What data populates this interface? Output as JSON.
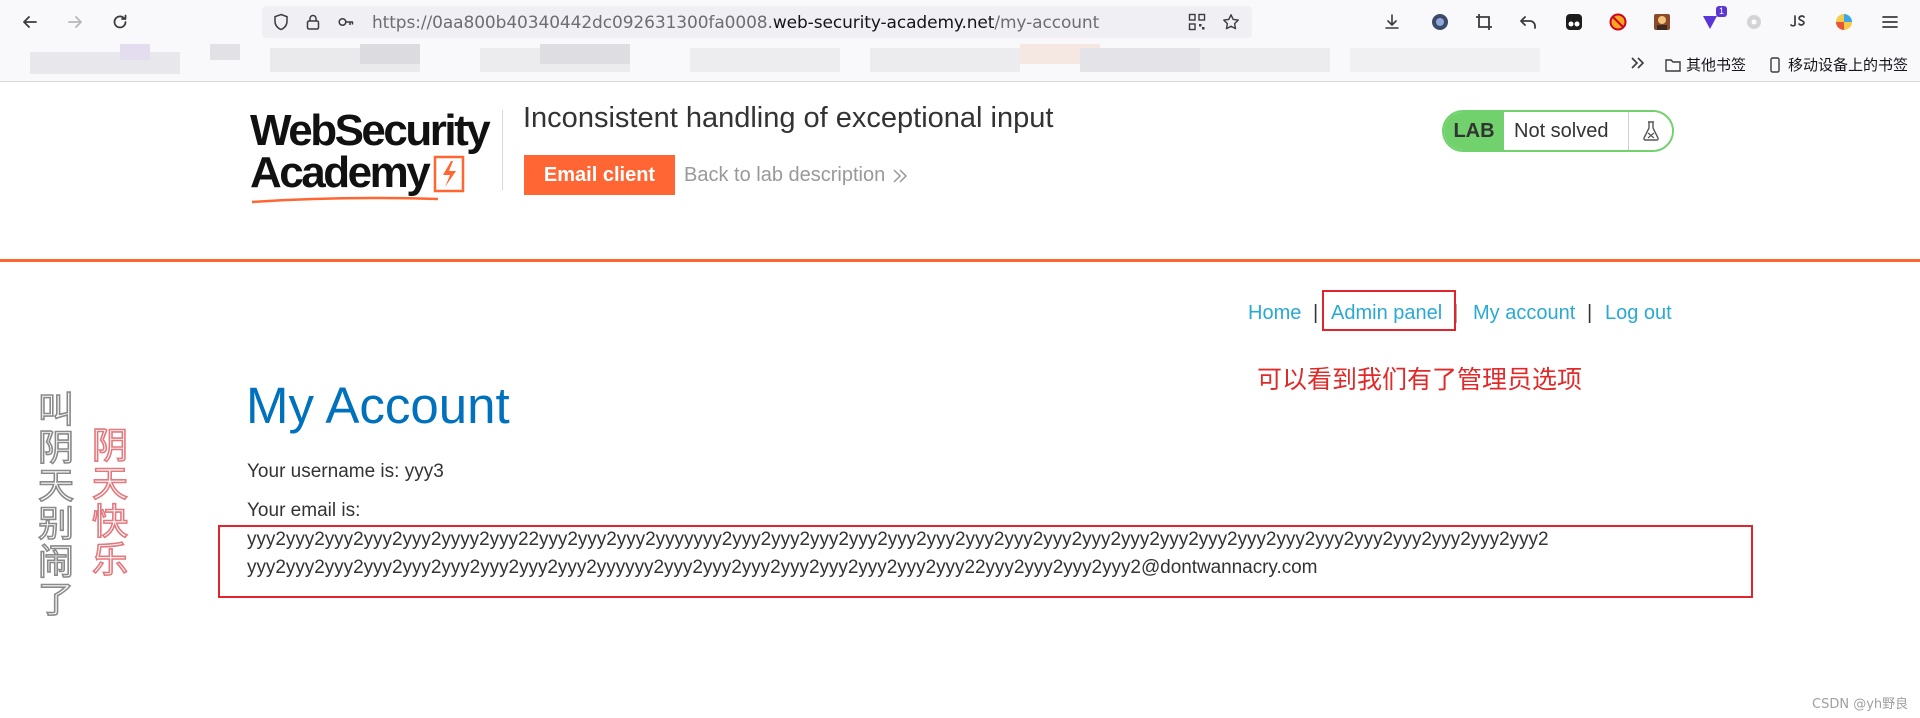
{
  "browser": {
    "url_prefix": "https://0aa800b40340442dc092631300fa0008.",
    "url_domain": "web-security-academy.net",
    "url_path": "/my-account",
    "extension_badge": "1",
    "bookmarks_other": "其他书签",
    "bookmarks_mobile": "移动设备上的书签"
  },
  "lab": {
    "logo_line1": "WebSecurity",
    "logo_line2": "Academy",
    "title": "Inconsistent handling of exceptional input",
    "email_client_label": "Email client",
    "back_link_label": "Back to lab description",
    "status_badge": "LAB",
    "status_text": "Not solved"
  },
  "nav": {
    "home": "Home",
    "admin_panel": "Admin panel",
    "my_account": "My account",
    "log_out": "Log out",
    "separator": "|"
  },
  "annotation": {
    "note": "可以看到我们有了管理员选项"
  },
  "account": {
    "heading": "My Account",
    "username_line": "Your username is: yyy3",
    "email_label": "Your email is:",
    "email_line1": "yyy2yyy2yyy2yyy2yyy2yyyy2yyy22yyy2yyy2yyy2yyyyyyy2yyy2yyy2yyy2yyy2yyy2yyy2yyy2yyy2yyy2yyy2yyy2yyy2yyy2yyy2yyy2yyy2yyy2yyy2yyy2yyy2yyy2",
    "email_line2": "yyy2yyy2yyy2yyy2yyy2yyy2yyy2yyy2yyy2yyyyyy2yyy2yyy2yyy2yyy2yyy2yyy2yyy2yyy22yyy2yyy2yyy2yyy2@dontwannacry.com"
  },
  "watermark": {
    "gray": [
      "叫",
      "阴",
      "天",
      "别",
      "闹",
      "了"
    ],
    "red": [
      "阴",
      "天",
      "快",
      "乐"
    ]
  },
  "footer": {
    "credit": "CSDN @yh野良"
  },
  "colors": {
    "accent": "#ff6633",
    "link": "#29a9d3",
    "title_blue": "#0071bc",
    "lab_green": "#70d16d",
    "annotation_red": "#e0252f"
  }
}
